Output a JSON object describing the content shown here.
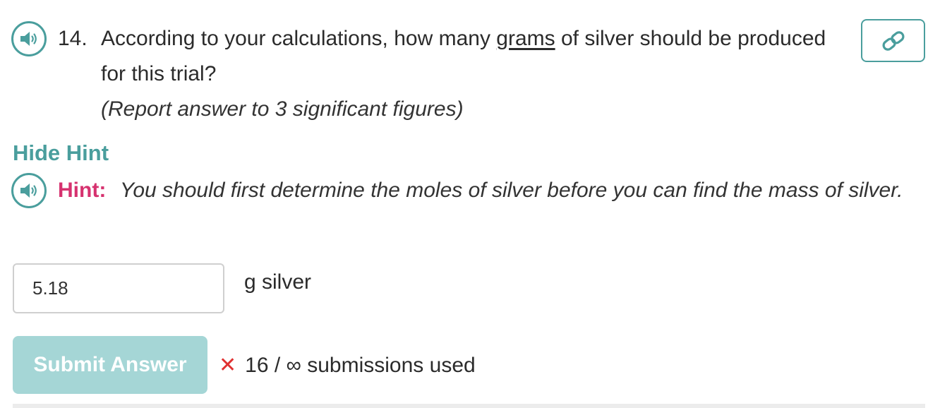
{
  "question": {
    "number": "14.",
    "text_before": "According to your calculations, how many ",
    "text_emphasis": "grams",
    "text_after": " of silver should be produced for this trial?",
    "note": "(Report answer to 3 significant figures)"
  },
  "hint_toggle": {
    "label": "Hide Hint"
  },
  "hint": {
    "label": "Hint:",
    "text": "You should first determine the moles of silver before you can find the mass of silver."
  },
  "answer": {
    "value": "5.18",
    "unit": "g silver"
  },
  "submit": {
    "label": "Submit Answer"
  },
  "status": {
    "mark": "✕",
    "text": "16 / ∞ submissions used"
  },
  "icons": {
    "audio": "speaker-icon",
    "link": "link-icon",
    "error": "close-icon"
  },
  "colors": {
    "accent": "#4a9e9d",
    "hint_label": "#d6326f",
    "submit_bg": "#a5d6d6",
    "error": "#e03131"
  }
}
